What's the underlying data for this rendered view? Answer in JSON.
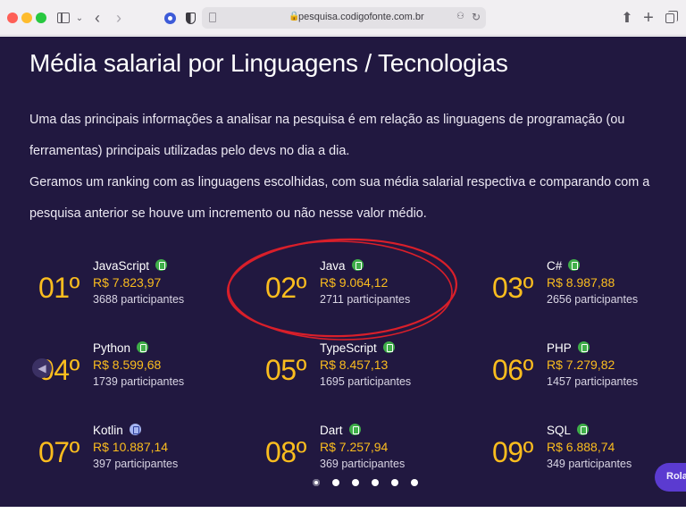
{
  "browser": {
    "url": "pesquisa.codigofonte.com.br"
  },
  "page": {
    "title": "Média salarial por Linguagens / Tecnologias",
    "paragraph1": "Uma das principais informações a analisar na pesquisa é em relação as linguagens de programação (ou ferramentas) principais utilizadas pelo devs no dia a dia.",
    "paragraph2": "Geramos um ranking com as linguagens escolhidas, com sua média salarial respectiva e comparando com a pesquisa anterior se houve um incremento ou não nesse valor médio."
  },
  "ranking": [
    {
      "rank": "01º",
      "language": "JavaScript",
      "salary": "R$ 7.823,97",
      "participants": "3688 participantes",
      "badge_color": "#3fae49"
    },
    {
      "rank": "02º",
      "language": "Java",
      "salary": "R$ 9.064,12",
      "participants": "2711 participantes",
      "badge_color": "#3fae49"
    },
    {
      "rank": "03º",
      "language": "C#",
      "salary": "R$ 8.987,88",
      "participants": "2656 participantes",
      "badge_color": "#3fae49"
    },
    {
      "rank": "04º",
      "language": "Python",
      "salary": "R$ 8.599,68",
      "participants": "1739 participantes",
      "badge_color": "#3fae49"
    },
    {
      "rank": "05º",
      "language": "TypeScript",
      "salary": "R$ 8.457,13",
      "participants": "1695 participantes",
      "badge_color": "#3fae49"
    },
    {
      "rank": "06º",
      "language": "PHP",
      "salary": "R$ 7.279,82",
      "participants": "1457 participantes",
      "badge_color": "#3fae49"
    },
    {
      "rank": "07º",
      "language": "Kotlin",
      "salary": "R$ 10.887,14",
      "participants": "397 participantes",
      "badge_color": "#a5b4f0"
    },
    {
      "rank": "08º",
      "language": "Dart",
      "salary": "R$ 7.257,94",
      "participants": "369 participantes",
      "badge_color": "#3fae49"
    },
    {
      "rank": "09º",
      "language": "SQL",
      "salary": "R$ 6.888,74",
      "participants": "349 participantes",
      "badge_color": "#3fae49"
    }
  ],
  "pagination": {
    "active_index": 0,
    "count": 6
  },
  "scroll_button": {
    "label": "Rola"
  },
  "colors": {
    "page_background": "#211840",
    "accent_yellow": "#fbbd1e",
    "highlight_ring": "#d91f2a"
  }
}
